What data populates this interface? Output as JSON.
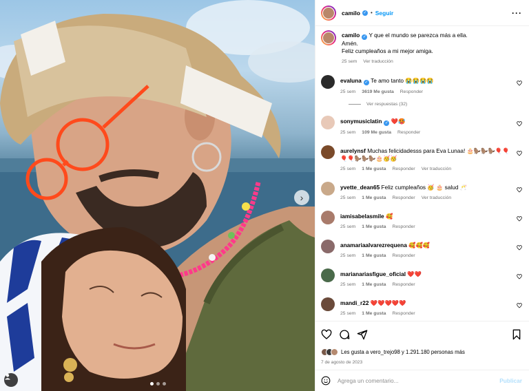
{
  "post": {
    "username": "camilo",
    "follow_label": "Seguir",
    "caption_lines": [
      "Y que el mundo se parezca más a ella.",
      "Amén.",
      "Feliz cumpleaños a mi mejor amiga."
    ],
    "caption_time": "25 sem",
    "caption_translate": "Ver traducción"
  },
  "comments": [
    {
      "user": "evaluna",
      "verified": true,
      "text": "Te amo tanto 😭😭😭😭",
      "time": "25 sem",
      "likes": "3619 Me gusta",
      "reply": "Responder",
      "translate": "",
      "avatar_color": "#2a2a2a"
    },
    {
      "user": "sonymusiclatin",
      "verified": true,
      "text": "❤️🥵",
      "time": "25 sem",
      "likes": "109 Me gusta",
      "reply": "Responder",
      "translate": "",
      "avatar_color": "#e8c9b8"
    },
    {
      "user": "aurelynsf",
      "verified": false,
      "text": "Muchas felicidadesss para Eva Lunaa! 🎂🦫🦫🦫🎈🎈🎈🎈🦫🦫🦫🎂🥳🥳",
      "time": "25 sem",
      "likes": "1 Me gusta",
      "reply": "Responder",
      "translate": "Ver traducción",
      "avatar_color": "#7a4a2a"
    },
    {
      "user": "yvette_dean65",
      "verified": false,
      "text": "Feliz cumpleaños 🥳 🎂 salud 🥂",
      "time": "25 sem",
      "likes": "1 Me gusta",
      "reply": "Responder",
      "translate": "Ver traducción",
      "avatar_color": "#c9a98a"
    },
    {
      "user": "iamisabelasmile",
      "verified": false,
      "text": "🥰",
      "time": "25 sem",
      "likes": "1 Me gusta",
      "reply": "Responder",
      "translate": "",
      "avatar_color": "#a97b6b"
    },
    {
      "user": "anamariaalvarezrequena",
      "verified": false,
      "text": "🥰🥰🥰",
      "time": "25 sem",
      "likes": "1 Me gusta",
      "reply": "Responder",
      "translate": "",
      "avatar_color": "#8a6a6a"
    },
    {
      "user": "marianariasfigue_oficial",
      "verified": false,
      "text": "❤️❤️",
      "time": "25 sem",
      "likes": "1 Me gusta",
      "reply": "Responder",
      "translate": "",
      "avatar_color": "#4a6a4a"
    },
    {
      "user": "mandi_r22",
      "verified": false,
      "text": "❤️❤️❤️❤️❤️",
      "time": "25 sem",
      "likes": "1 Me gusta",
      "reply": "Responder",
      "translate": "",
      "avatar_color": "#6a4a3a"
    }
  ],
  "replies_label": "Ver respuestas (32)",
  "likes_summary": "Les gusta a vero_trejo98 y 1.291.180 personas más",
  "date": "7 de agosto de 2023",
  "add_comment": {
    "placeholder": "Agrega un comentario...",
    "publish": "Publicar"
  },
  "colors": {
    "accent": "#0095f6",
    "verified": "#3897f0",
    "muted": "#737373"
  }
}
